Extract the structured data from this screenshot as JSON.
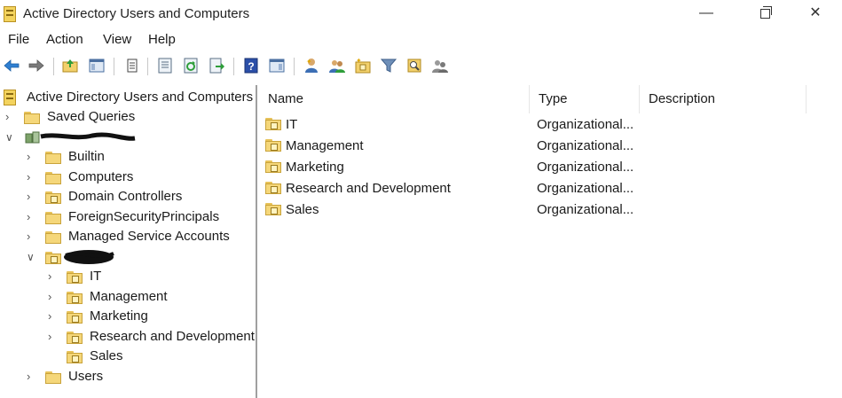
{
  "window": {
    "title": "Active Directory Users and Computers",
    "minimize": "—",
    "close": "✕"
  },
  "menu": [
    "File",
    "Action",
    "View",
    "Help"
  ],
  "toolbar": {
    "buttons": [
      "back-icon",
      "forward-icon",
      "up-folder-icon",
      "show-console-tree-icon",
      "delete-icon",
      "properties-icon",
      "refresh-icon",
      "export-list-icon",
      "help-icon",
      "show-action-pane-icon",
      "new-user-icon",
      "new-group-icon",
      "new-ou-icon",
      "filter-icon",
      "find-icon",
      "add-to-group-icon"
    ]
  },
  "tree": {
    "root_label": "Active Directory Users and Computers [",
    "saved_queries": "Saved Queries",
    "domain_children": [
      "Builtin",
      "Computers",
      "Domain Controllers",
      "ForeignSecurityPrincipals",
      "Managed Service Accounts"
    ],
    "ou_children": [
      "IT",
      "Management",
      "Marketing",
      "Research and Development",
      "Sales"
    ],
    "users": "Users"
  },
  "list": {
    "columns": [
      "Name",
      "Type",
      "Description"
    ],
    "rows": [
      {
        "name": "IT",
        "type": "Organizational...",
        "description": ""
      },
      {
        "name": "Management",
        "type": "Organizational...",
        "description": ""
      },
      {
        "name": "Marketing",
        "type": "Organizational...",
        "description": ""
      },
      {
        "name": "Research and Development",
        "type": "Organizational...",
        "description": ""
      },
      {
        "name": "Sales",
        "type": "Organizational...",
        "description": ""
      }
    ]
  }
}
